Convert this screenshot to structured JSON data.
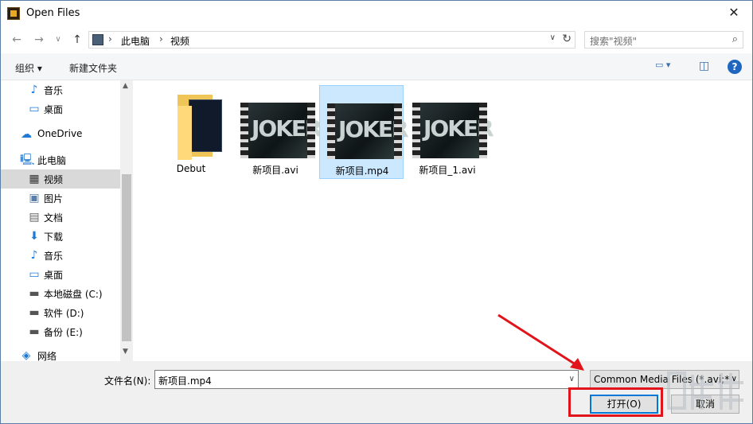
{
  "window": {
    "title": "Open Files",
    "close_glyph": "✕"
  },
  "nav": {
    "back": "←",
    "forward": "→",
    "recent": "∨",
    "up": "↑"
  },
  "address": {
    "crumbs": [
      "此电脑",
      "视频"
    ],
    "sep": "›",
    "dropdown": "∨",
    "refresh": "↻"
  },
  "search": {
    "placeholder": "搜索\"视频\"",
    "icon": "⌕"
  },
  "toolbar": {
    "organize": "组织 ▾",
    "new_folder": "新建文件夹",
    "view_icon": "▭ ▾",
    "pane_icon": "◫",
    "help": "?"
  },
  "sidebar": {
    "items": [
      {
        "label": "音乐",
        "icon": "♪",
        "color": "#1f7ad6"
      },
      {
        "label": "桌面",
        "icon": "▭",
        "color": "#1f7ad6"
      },
      {
        "label": "OneDrive",
        "icon": "☁",
        "color": "#1f7ad6"
      },
      {
        "label": "此电脑",
        "icon": "🖳",
        "color": "#4a8fd6"
      },
      {
        "label": "视频",
        "icon": "▦",
        "color": "#333333"
      },
      {
        "label": "图片",
        "icon": "▣",
        "color": "#5a7fa8"
      },
      {
        "label": "文档",
        "icon": "▤",
        "color": "#666666"
      },
      {
        "label": "下载",
        "icon": "⬇",
        "color": "#1f7ad6"
      },
      {
        "label": "音乐",
        "icon": "♪",
        "color": "#1f7ad6"
      },
      {
        "label": "桌面",
        "icon": "▭",
        "color": "#1f7ad6"
      },
      {
        "label": "本地磁盘 (C:)",
        "icon": "▬",
        "color": "#555555"
      },
      {
        "label": "软件 (D:)",
        "icon": "▬",
        "color": "#555555"
      },
      {
        "label": "备份 (E:)",
        "icon": "▬",
        "color": "#555555"
      },
      {
        "label": "网络",
        "icon": "◈",
        "color": "#1f7ad6"
      }
    ],
    "scroll_up": "▲",
    "scroll_down": "▼"
  },
  "files": [
    {
      "name": "Debut",
      "type": "folder"
    },
    {
      "name": "新项目.avi",
      "type": "video",
      "thumb_text": "JOKER"
    },
    {
      "name": "新项目.mp4",
      "type": "video",
      "thumb_text": "JOKER"
    },
    {
      "name": "新项目_1.avi",
      "type": "video",
      "thumb_text": "JOKER"
    }
  ],
  "bottom": {
    "filename_label": "文件名(N):",
    "filename_value": "新项目.mp4",
    "filename_dropdown": "∨",
    "filter_value": "Common Media Files (*.avi;*",
    "filter_dropdown": "∨",
    "open_button": "打开(O)",
    "cancel_button": "取消"
  },
  "colors": {
    "selection": "#cce8ff",
    "accent": "#0078d7",
    "annotation": "#e0141a"
  }
}
